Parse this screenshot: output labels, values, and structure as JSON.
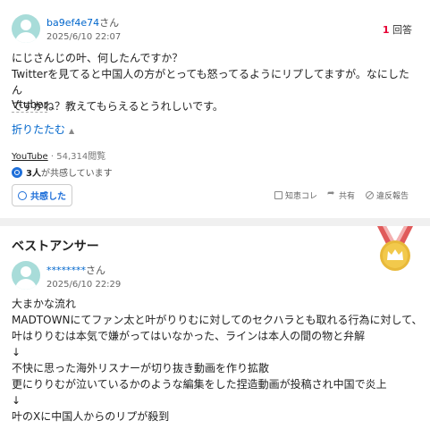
{
  "question": {
    "username": "ba9ef4e74",
    "honorific": "さん",
    "date": "2025/6/10 22:07",
    "answers_count": "1",
    "answers_label": "回答",
    "body_lines": [
      "にじさんじの叶、何したんですか？",
      "Twitterを見てると中国人の方がとっても怒ってるようにリプしてますが。なにしたん",
      "ですかね？教えてもらえるとうれしいです。"
    ],
    "tag": "Vtuber",
    "fold_label": "折りたたむ",
    "category": "YouTube",
    "views": "54,314閲覧",
    "empathy_count": "3人",
    "empathy_text": "が共感しています",
    "empathy_button": "共感した",
    "actions": {
      "bookmark": "知恵コレ",
      "share": "共有",
      "report": "違反報告"
    }
  },
  "best_answer": {
    "title": "ベストアンサー",
    "username": "********",
    "honorific": "さん",
    "date": "2025/6/10 22:29",
    "body_lines": [
      "大まかな流れ",
      "MADTOWNにてファン太と叶がりりむに対してのセクハラとも取れる行為に対して、",
      "叶はりりむは本気で嫌がってはいなかった、ラインは本人の間の物と弁解",
      "↓",
      "不快に思った海外リスナーが切り抜き動画を作り拡散",
      "更にりりむが泣いているかのような編集をした捏造動画が投稿され中国で炎上",
      "↓",
      "叶のXに中国人からのリプが殺到"
    ]
  },
  "colors": {
    "link": "#0066cc",
    "accent_red": "#e60033",
    "empathy_blue": "#1e6fd9",
    "avatar": "#a8dcd9",
    "medal_gold": "#e8b93a",
    "ribbon_red": "#e05a5a"
  },
  "icons": {
    "avatar": "user-avatar-icon",
    "empathy": "empathy-icon",
    "bookmark": "bookmark-icon",
    "share": "share-icon",
    "report": "report-icon",
    "medal": "crown-medal-icon"
  }
}
